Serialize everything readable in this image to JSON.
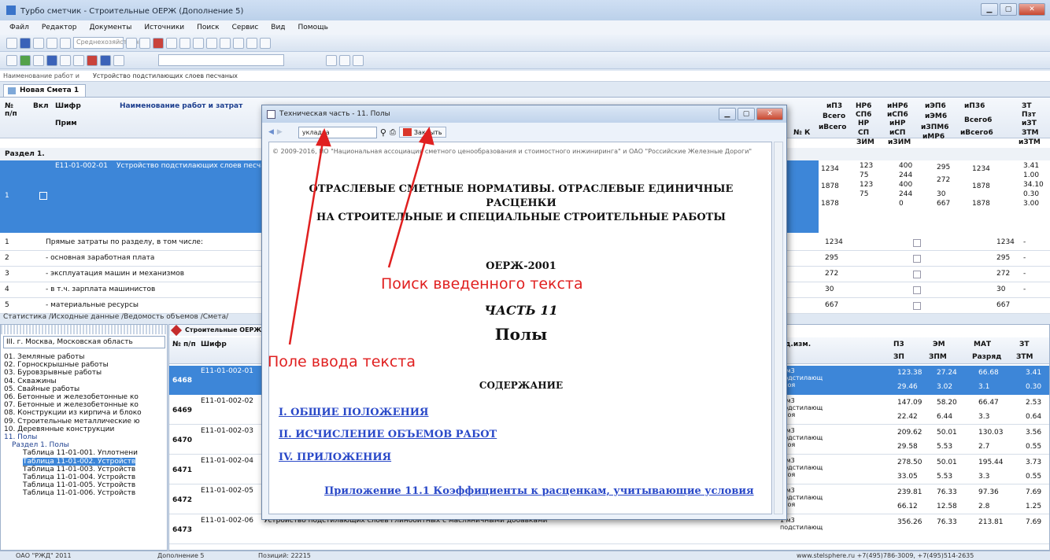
{
  "window": {
    "title": "Турбо сметчик - Строительные ОЕРЖ (Дополнение 5)"
  },
  "menu": [
    "Файл",
    "Редактор",
    "Документы",
    "Источники",
    "Поиск",
    "Сервис",
    "Вид",
    "Помощь"
  ],
  "toolbar": {
    "combo1": "Среднехозяйственно"
  },
  "namefield": {
    "label": "Наименование работ и",
    "value": "Устройство подстилающих слоев песчаных"
  },
  "doc_tab": "Новая Смета 1",
  "grid1": {
    "h_no": "№ п/п",
    "h_vkl": "Вкл",
    "h_shifr": "Шифр",
    "h_name": "Наименование работ и затрат",
    "h_prim": "Прим",
    "h_r1": [
      "иП3",
      "НР6",
      "иНР6",
      "иЭП6",
      "иП36",
      "ЗТ"
    ],
    "h_r2": [
      "Всего",
      "СП6",
      "иСП6",
      "иЭМ6",
      "Всего6",
      "Пзт"
    ],
    "h_r3": [
      "иВсего",
      "НР",
      "иНР",
      "иЗПМ6",
      "",
      "иЗТ"
    ],
    "h_r4": [
      "№ К",
      "СП",
      "иСП",
      "иМР6",
      "иВсего6",
      "ЗТМ"
    ],
    "h_r5": [
      "",
      "ЗИМ",
      "иЗИМ",
      "",
      "",
      "иЗТМ"
    ],
    "section": "Раздел 1.",
    "row1": {
      "num": "1",
      "code": "Е11-01-002-01",
      "name": "Устройство подстилающих слоев песча",
      "c1": [
        "1234",
        "1878",
        "1878"
      ],
      "c2": [
        "123",
        "75",
        "123",
        "75"
      ],
      "c3": [
        "400",
        "244",
        "400",
        "244",
        "0"
      ],
      "c4": [
        "295",
        "272",
        "30",
        "667"
      ],
      "c5": [
        "1234",
        "1878",
        "1878"
      ],
      "c6": [
        "3.41",
        "1.00",
        "34.10",
        "0.30",
        "3.00"
      ]
    },
    "sum": [
      {
        "n": "1",
        "label": "Прямые затраты по разделу, в том числе:",
        "a": "1234",
        "b": "1234",
        "c": "-"
      },
      {
        "n": "2",
        "label": "- основная заработная плата",
        "a": "295",
        "b": "295",
        "c": "-"
      },
      {
        "n": "3",
        "label": "- эксплуатация машин и механизмов",
        "a": "272",
        "b": "272",
        "c": "-"
      },
      {
        "n": "4",
        "label": "- в т.ч. зарплата машинистов",
        "a": "30",
        "b": "30",
        "c": "-"
      },
      {
        "n": "5",
        "label": "- материальные ресурсы",
        "a": "667",
        "b": "667",
        "c": ""
      }
    ]
  },
  "bottom_tabs": "Статистика /Исходные данные /Ведомость объемов /Смета/",
  "tree": {
    "region": "III. г. Москва, Московская область",
    "items": [
      "01. Земляные работы",
      "02. Горноскрышные работы",
      "03. Буровзрывные работы",
      "04. Скважины",
      "05. Свайные работы",
      "06. Бетонные и железобетонные ко",
      "07. Бетонные и железобетонные ко",
      "08. Конструкции из кирпича и блоко",
      "09. Строительные металлические ю",
      "10. Деревянные конструкции",
      "11. Полы",
      "Раздел 1. Полы",
      "Таблица 11-01-001. Уплотнени",
      "Таблица 11-01-002. Устройств",
      "Таблица 11-01-003. Устройств",
      "Таблица 11-01-004. Устройств",
      "Таблица 11-01-005. Устройств",
      "Таблица 11-01-006. Устройств"
    ]
  },
  "grid2": {
    "tab": "Строительные ОЕРЖ",
    "h": [
      "№ п/п",
      "Шифр",
      "Ед.изм.",
      "П3",
      "ЭМ",
      "МАТ",
      "ЗТ",
      "ЗП",
      "ЗПМ",
      "Разряд",
      "ЗТМ"
    ],
    "rows": [
      {
        "n": "6468",
        "code": "Е11-01-002-01",
        "name": "",
        "unit": "1 м3 подстилающ слоя",
        "v": [
          "123.38",
          "27.24",
          "66.68",
          "3.41",
          "29.46",
          "3.02",
          "3.1",
          "0.30"
        ]
      },
      {
        "n": "6469",
        "code": "Е11-01-002-02",
        "name": "",
        "unit": "1 м3 подстилающ слоя",
        "v": [
          "147.09",
          "58.20",
          "66.47",
          "2.53",
          "22.42",
          "6.44",
          "3.3",
          "0.64"
        ]
      },
      {
        "n": "6470",
        "code": "Е11-01-002-03",
        "name": "",
        "unit": "1 м3 подстилающ слоя",
        "v": [
          "209.62",
          "50.01",
          "130.03",
          "3.56",
          "29.58",
          "5.53",
          "2.7",
          "0.55"
        ]
      },
      {
        "n": "6471",
        "code": "Е11-01-002-04",
        "name": "",
        "unit": "1 м3 подстилающ слоя",
        "v": [
          "278.50",
          "50.01",
          "195.44",
          "3.73",
          "33.05",
          "5.53",
          "3.3",
          "0.55"
        ]
      },
      {
        "n": "6472",
        "code": "Е11-01-002-05",
        "name": "Устройство подстилающих слоев глинобитных без добавок",
        "unit": "1 м3 подстилающ слоя",
        "v": [
          "239.81",
          "76.33",
          "97.36",
          "7.69",
          "66.12",
          "12.58",
          "2.8",
          "1.25"
        ]
      },
      {
        "n": "6473",
        "code": "Е11-01-002-06",
        "name": "Устройство подстилающих слоев глинобитных с масляничными добавками",
        "unit": "1 м3 подстилающ",
        "v": [
          "356.26",
          "76.33",
          "213.81",
          "7.69",
          "",
          "",
          "",
          ""
        ]
      }
    ]
  },
  "status": {
    "s1": "ОАО \"РЖД\" 2011",
    "s2": "Дополнение 5",
    "s3": "Позиций: 22215",
    "s4": "www.stelsphere.ru  +7(495)786-3009, +7(495)514-2635"
  },
  "dialog": {
    "title": "Техническая часть - 11. Полы",
    "search": "укладка",
    "close": "Закрыть",
    "copyright": "© 2009-2016, НО \"Национальная ассоциация сметного ценообразования и стоимостного инжиниринга\" и ОАО \"Российские Железные Дороги\"",
    "h1": "ОТРАСЛЕВЫЕ СМЕТНЫЕ НОРМАТИВЫ. ОТРАСЛЕВЫЕ ЕДИНИЧНЫЕ",
    "h2": "РАСЦЕНКИ",
    "h3": "НА СТРОИТЕЛЬНЫЕ И СПЕЦИАЛЬНЫЕ СТРОИТЕЛЬНЫЕ РАБОТЫ",
    "code": "ОЕРЖ-2001",
    "part": "ЧАСТЬ 11",
    "floors": "Полы",
    "contents": "СОДЕРЖАНИЕ",
    "links": [
      "I. ОБЩИЕ ПОЛОЖЕНИЯ",
      "II. ИСЧИСЛЕНИЕ ОБЪЕМОВ РАБОТ",
      "IV. ПРИЛОЖЕНИЯ",
      "Приложение 11.1 Коэффициенты к расценкам, учитывающие условия"
    ]
  },
  "annotations": {
    "a1": "Поиск введенного текста",
    "a2": "Поле ввода текста"
  },
  "colors": {
    "annot": "#e02020",
    "selection": "#3d86d8",
    "link": "#2a49c8"
  }
}
